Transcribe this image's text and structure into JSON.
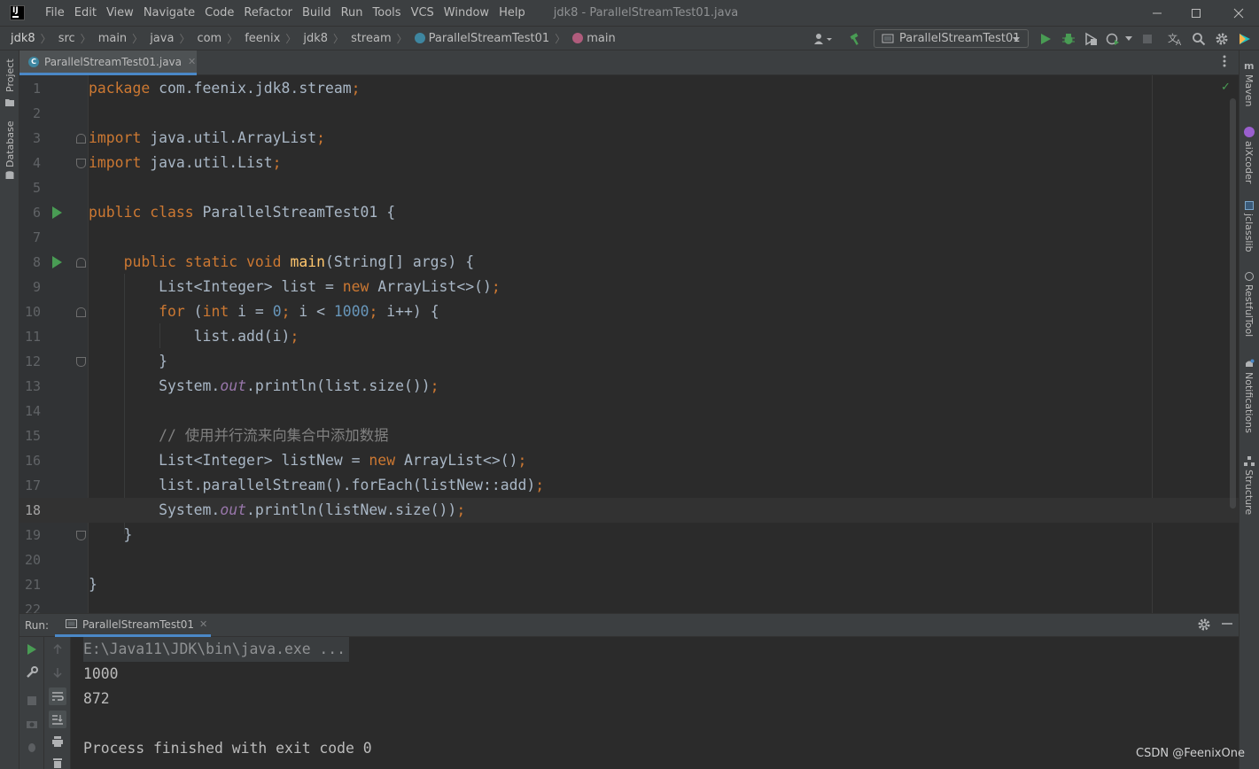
{
  "menu": {
    "items": [
      "File",
      "Edit",
      "View",
      "Navigate",
      "Code",
      "Refactor",
      "Build",
      "Run",
      "Tools",
      "VCS",
      "Window",
      "Help"
    ],
    "window_title": "jdk8 - ParallelStreamTest01.java"
  },
  "breadcrumb": {
    "items": [
      "jdk8",
      "src",
      "main",
      "java",
      "com",
      "feenix",
      "jdk8",
      "stream",
      "ParallelStreamTest01",
      "main"
    ]
  },
  "toolbar": {
    "run_config": "ParallelStreamTest01"
  },
  "left_stripe": {
    "project": "Project",
    "database": "Database"
  },
  "right_stripe": {
    "maven": "Maven",
    "aixcoder": "aiXcoder",
    "jclasslib": "jclasslib",
    "restfultool": "RestfulTool",
    "notifications": "Notifications",
    "structure": "Structure"
  },
  "editor": {
    "tab_label": "ParallelStreamTest01.java",
    "current_line": 18,
    "lines": [
      {
        "n": "1"
      },
      {
        "n": "2"
      },
      {
        "n": "3"
      },
      {
        "n": "4"
      },
      {
        "n": "5"
      },
      {
        "n": "6"
      },
      {
        "n": "7"
      },
      {
        "n": "8"
      },
      {
        "n": "9"
      },
      {
        "n": "10"
      },
      {
        "n": "11"
      },
      {
        "n": "12"
      },
      {
        "n": "13"
      },
      {
        "n": "14"
      },
      {
        "n": "15"
      },
      {
        "n": "16"
      },
      {
        "n": "17"
      },
      {
        "n": "18"
      },
      {
        "n": "19"
      },
      {
        "n": "20"
      },
      {
        "n": "21"
      },
      {
        "n": "22"
      }
    ],
    "code": {
      "l1_kw": "package",
      "l1_rest": " com.feenix.jdk8.stream",
      "l1_semi": ";",
      "l3_kw": "import",
      "l3_rest": " java.util.ArrayList",
      "l3_semi": ";",
      "l4_kw": "import",
      "l4_rest": " java.util.List",
      "l4_semi": ";",
      "l6_kw": "public class",
      "l6_rest": " ParallelStreamTest01 {",
      "l8_indent": "    ",
      "l8_kw": "public static void",
      "l8_sp": " ",
      "l8_fn": "main",
      "l8_rest": "(String[] args) {",
      "l9_a": "        List<Integer> list = ",
      "l9_kw": "new",
      "l9_b": " ArrayList<>()",
      "l9_semi": ";",
      "l10_indent": "        ",
      "l10_kw1": "for",
      "l10_a": " (",
      "l10_kw2": "int",
      "l10_b": " i = ",
      "l10_n1": "0",
      "l10_s1": ";",
      "l10_c": " i < ",
      "l10_n2": "1000",
      "l10_s2": ";",
      "l10_d": " i++) {",
      "l11_a": "            list.add(i)",
      "l11_semi": ";",
      "l12_a": "        }",
      "l13_a": "        System.",
      "l13_st": "out",
      "l13_b": ".println(list.size())",
      "l13_semi": ";",
      "l15_cm": "        // 使用并行流来向集合中添加数据",
      "l16_a": "        List<Integer> listNew = ",
      "l16_kw": "new",
      "l16_b": " ArrayList<>()",
      "l16_semi": ";",
      "l17_a": "        list.parallelStream().forEach(listNew::add)",
      "l17_semi": ";",
      "l18_a": "        System.",
      "l18_st": "out",
      "l18_b": ".println(listNew.size())",
      "l18_semi": ";",
      "l19_a": "    }",
      "l21_a": "}"
    }
  },
  "run_panel": {
    "label": "Run:",
    "tab_label": "ParallelStreamTest01",
    "console": {
      "cmd": "E:\\Java11\\JDK\\bin\\java.exe ...",
      "out1": "1000",
      "out2": "872",
      "blank": "",
      "exit": "Process finished with exit code 0"
    }
  },
  "watermark": "CSDN @FeenixOne"
}
